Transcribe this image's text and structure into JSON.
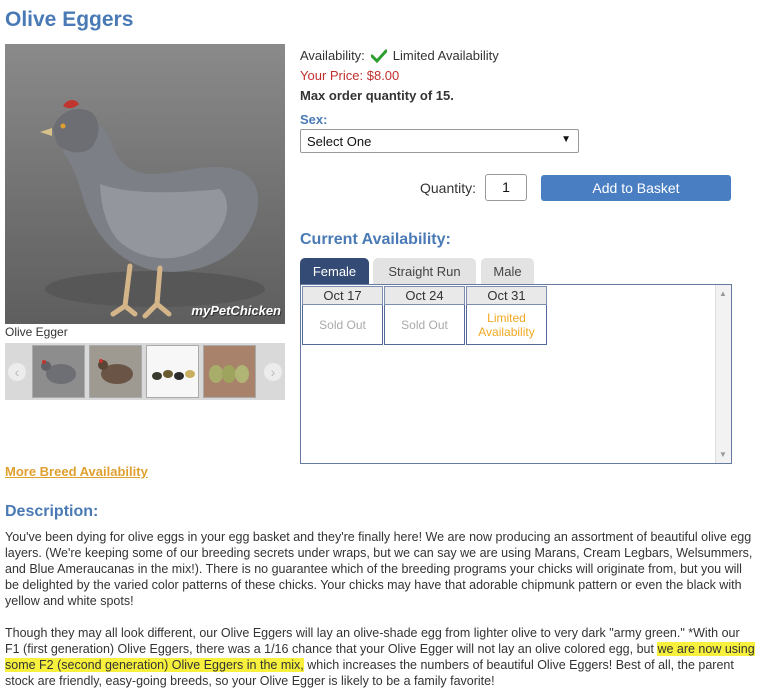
{
  "product": {
    "title": "Olive Eggers",
    "photo_caption": "Olive Egger",
    "watermark": "myPetChicken"
  },
  "purchase": {
    "availability_label": "Availability:",
    "availability_value": "Limited Availability",
    "price_label": "Your Price:",
    "price_value": "$8.00",
    "max_order": "Max order quantity of 15.",
    "sex_label": "Sex:",
    "sex_selected": "Select One",
    "quantity_label": "Quantity:",
    "quantity_value": "1",
    "add_button": "Add to Basket"
  },
  "availability": {
    "heading": "Current Availability:",
    "tabs": [
      "Female",
      "Straight Run",
      "Male"
    ],
    "active_tab": "Female",
    "dates": [
      {
        "date": "Oct 17",
        "status": "Sold Out"
      },
      {
        "date": "Oct 24",
        "status": "Sold Out"
      },
      {
        "date": "Oct 31",
        "status": "Limited Availability"
      }
    ],
    "more_link": "More Breed Availability"
  },
  "description": {
    "heading": "Description:",
    "p1": "You've been dying for olive eggs in your egg basket and they're finally here!  We are now producing an assortment of beautiful olive egg layers. (We're keeping some of our breeding secrets under wraps, but we can say we are using Marans, Cream Legbars, Welsummers, and Blue Ameraucanas in the mix!). There is no guarantee which of the breeding programs your chicks will originate from, but you will be delighted by the varied color patterns of these chicks. Your chicks may have that adorable chipmunk pattern or even the black with yellow and white spots!",
    "p2_start": "Though they may all look different, our Olive Eggers will lay an olive-shade egg from lighter olive to very dark \"army green.\" *With our F1 (first generation) Olive Eggers, there was a 1/16 chance that your Olive Egger will not lay an olive colored egg, but ",
    "p2_highlight": "we are now using some F2 (second generation) Olive Eggers in the mix,",
    "p2_end": " which increases the numbers of beautiful Olive Eggers!  Best of all, the parent stock are friendly, easy-going breeds, so your Olive Egger is likely to be a family favorite!"
  },
  "colors": {
    "accent": "#4a7ab5",
    "price": "#c0302e",
    "limited": "#f0a820",
    "tab_active": "#334b75",
    "check": "#2e9e2e"
  }
}
